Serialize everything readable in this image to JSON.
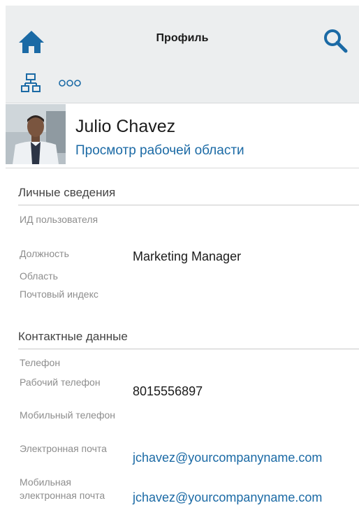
{
  "header": {
    "title": "Профиль",
    "home_icon": "home-icon",
    "search_icon": "search-icon",
    "org_icon": "org-chart-icon",
    "more_icon": "more-icon",
    "accent": "#1b6aa5"
  },
  "profile": {
    "name": "Julio Chavez",
    "workspace_link": "Просмотр рабочей области"
  },
  "personal": {
    "heading": "Личные сведения",
    "user_id_label": "ИД пользователя",
    "user_id_value": "",
    "position_label": "Должность",
    "position_value": "Marketing Manager",
    "region_label": "Область",
    "region_value": "",
    "postal_label": "Почтовый индекс",
    "postal_value": ""
  },
  "contact": {
    "heading": "Контактные данные",
    "phone_label": "Телефон",
    "phone_value": "",
    "work_phone_label": "Рабочий телефон",
    "work_phone_value": "8015556897",
    "mobile_phone_label": "Мобильный телефон",
    "mobile_phone_value": "",
    "email_label": "Электронная почта",
    "email_value": "jchavez@yourcompanyname.com",
    "mobile_email_label": "Мобильная электронная почта",
    "mobile_email_value": "jchavez@yourcompanyname.com"
  }
}
